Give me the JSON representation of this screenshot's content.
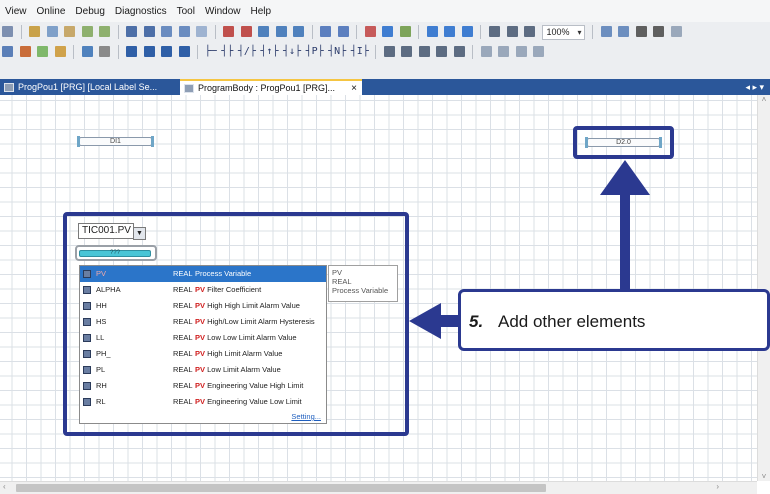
{
  "menu": [
    "View",
    "Online",
    "Debug",
    "Diagnostics",
    "Tool",
    "Window",
    "Help"
  ],
  "toolbar": {
    "zoom": "100%",
    "ladder_symbols": [
      "├─",
      "┤├",
      "┤/├",
      "┤↑├",
      "┤↓├",
      "┤P├",
      "┤N├",
      "┤I├"
    ]
  },
  "tabs": {
    "tab1": "ProgPou1 [PRG] [Local Label Se...",
    "tab2": "ProgramBody : ProgPou1 [PRG]...",
    "close": "×",
    "arrows": "◂ ▸ ▾"
  },
  "elements": {
    "contact1": "DI1",
    "contact2": "D2.0",
    "var_input": "TIC001.PV",
    "dropdown_arrow": "▼",
    "operand_placeholder": "???"
  },
  "autocomplete": {
    "rows": [
      {
        "name": "PV",
        "type": "REAL",
        "prefix": "",
        "desc": "Process Variable"
      },
      {
        "name": "ALPHA",
        "type": "REAL",
        "prefix": "PV",
        "desc": "Filter Coefficient"
      },
      {
        "name": "HH",
        "type": "REAL",
        "prefix": "PV",
        "desc": "High High Limit Alarm Value"
      },
      {
        "name": "HS",
        "type": "REAL",
        "prefix": "PV",
        "desc": "High/Low Limit Alarm Hysteresis"
      },
      {
        "name": "LL",
        "type": "REAL",
        "prefix": "PV",
        "desc": "Low Low Limit Alarm Value"
      },
      {
        "name": "PH_",
        "type": "REAL",
        "prefix": "PV",
        "desc": "High Limit Alarm Value"
      },
      {
        "name": "PL",
        "type": "REAL",
        "prefix": "PV",
        "desc": "Low Limit Alarm Value"
      },
      {
        "name": "RH",
        "type": "REAL",
        "prefix": "PV",
        "desc": "Engineering Value High Limit"
      },
      {
        "name": "RL",
        "type": "REAL",
        "prefix": "PV",
        "desc": "Engineering Value Low Limit"
      }
    ],
    "setting_link": "Setting..."
  },
  "tooltip": {
    "line1": "PV",
    "line2": "REAL",
    "line3": "Process Variable"
  },
  "callout": {
    "step": "5.",
    "text": "Add other elements"
  },
  "colors": {
    "highlight": "#2b3990",
    "selection": "#2b75c9",
    "tab_bar": "#2b579a"
  }
}
